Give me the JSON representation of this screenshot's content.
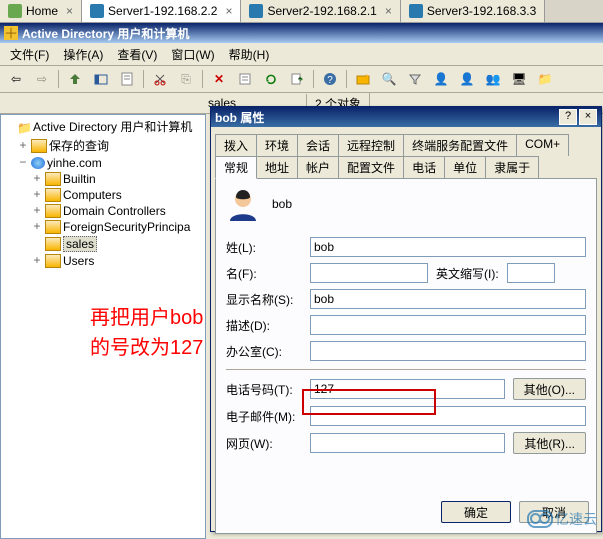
{
  "browser_tabs": [
    {
      "label": "Home",
      "icon": "#6aa84f"
    },
    {
      "label": "Server1-192.168.2.2",
      "icon": "#2a7ab0",
      "active": true
    },
    {
      "label": "Server2-192.168.2.1",
      "icon": "#2a7ab0"
    },
    {
      "label": "Server3-192.168.3.3",
      "icon": "#2a7ab0"
    }
  ],
  "window_title": "Active Directory 用户和计算机",
  "menus": [
    "文件(F)",
    "操作(A)",
    "查看(V)",
    "窗口(W)",
    "帮助(H)"
  ],
  "status": {
    "path": "sales",
    "objects": "2 个对象"
  },
  "tree": {
    "root": "Active Directory 用户和计算机",
    "saved_queries": "保存的查询",
    "domain": "yinhe.com",
    "children": [
      "Builtin",
      "Computers",
      "Domain Controllers",
      "ForeignSecurityPrincipa",
      "sales",
      "Users"
    ],
    "selected": "sales"
  },
  "dialog": {
    "title": "bob 属性",
    "tabs_row1": [
      "拨入",
      "环境",
      "会话",
      "远程控制",
      "终端服务配置文件",
      "COM+"
    ],
    "tabs_row2": [
      "常规",
      "地址",
      "帐户",
      "配置文件",
      "电话",
      "单位",
      "隶属于"
    ],
    "active_tab": "常规",
    "username": "bob",
    "fields": {
      "lastname_label": "姓(L):",
      "lastname_value": "bob",
      "firstname_label": "名(F):",
      "firstname_value": "",
      "initials_label": "英文缩写(I):",
      "initials_value": "",
      "display_label": "显示名称(S):",
      "display_value": "bob",
      "desc_label": "描述(D):",
      "desc_value": "",
      "office_label": "办公室(C):",
      "office_value": "",
      "phone_label": "电话号码(T):",
      "phone_value": "127",
      "phone_other": "其他(O)...",
      "email_label": "电子邮件(M):",
      "email_value": "",
      "web_label": "网页(W):",
      "web_value": "",
      "web_other": "其他(R)..."
    },
    "buttons": {
      "ok": "确定",
      "cancel": "取消"
    }
  },
  "annotation": {
    "line1": "再把用户bob",
    "line2": "的号改为127"
  },
  "watermark": "亿速云"
}
